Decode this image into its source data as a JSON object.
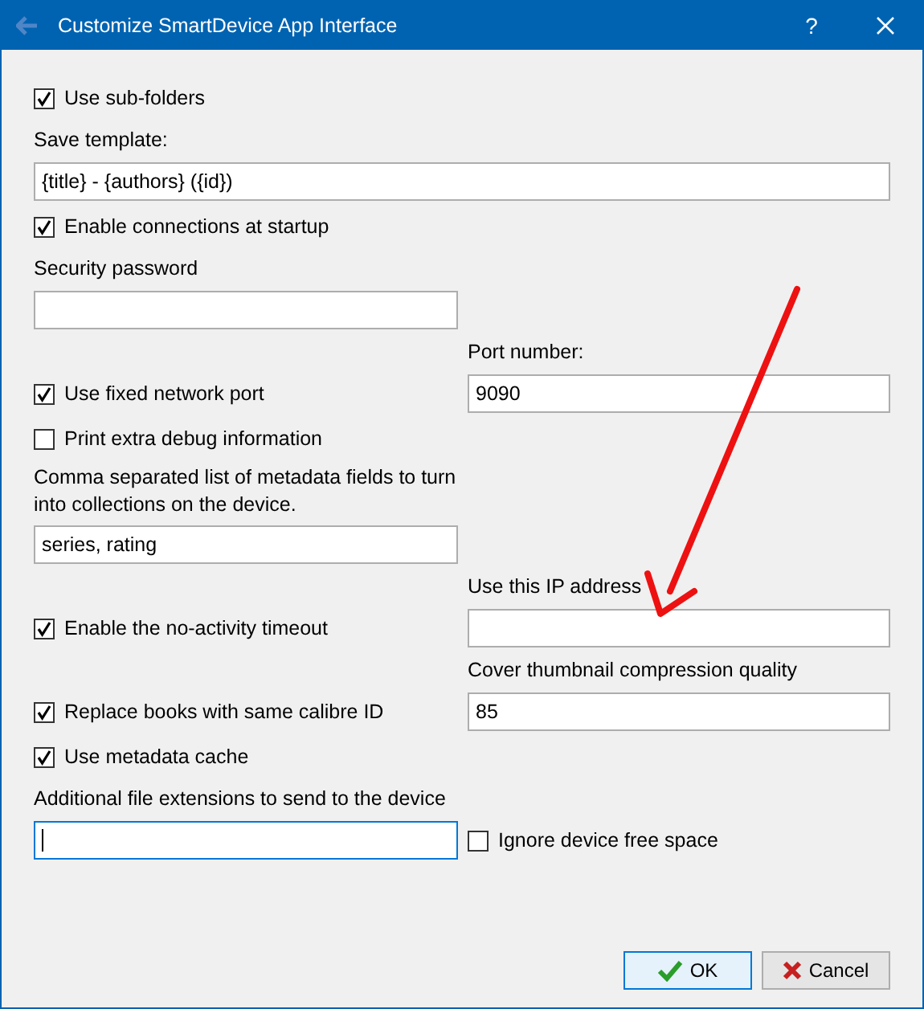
{
  "window": {
    "title": "Customize SmartDevice App Interface",
    "help": "?"
  },
  "rows": [
    {
      "full": {
        "kind": "checkbox",
        "label": "Use sub-folders",
        "checked": true
      }
    },
    {
      "full": {
        "kind": "label",
        "text": "Save template:"
      }
    },
    {
      "full": {
        "kind": "field",
        "value": "{title} - {authors} ({id})",
        "focused": false
      }
    },
    {
      "full": {
        "kind": "checkbox",
        "label": "Enable connections at startup",
        "checked": true
      }
    },
    {
      "left": {
        "kind": "label",
        "text": "Security password"
      }
    },
    {
      "left": {
        "kind": "field",
        "focused": false
      }
    },
    {
      "right": {
        "kind": "label",
        "text": "Port number:"
      }
    },
    {
      "left": {
        "kind": "checkbox",
        "label": "Use fixed network port",
        "checked": true
      },
      "right": {
        "kind": "field",
        "value": "9090",
        "focused": false
      }
    },
    {
      "left": {
        "kind": "checkbox",
        "label": "Print extra debug information",
        "checked": false
      }
    },
    {
      "left": {
        "kind": "label",
        "text": "Comma separated list of metadata fields to turn into collections on the device."
      }
    },
    {
      "left": {
        "kind": "field",
        "value": "series, rating",
        "focused": false
      }
    },
    {
      "right": {
        "kind": "label",
        "text": "Use this IP address"
      }
    },
    {
      "left": {
        "kind": "checkbox",
        "label": "Enable the no-activity timeout",
        "checked": true
      },
      "right": {
        "kind": "field",
        "focused": false
      }
    },
    {
      "right": {
        "kind": "label",
        "text": "Cover thumbnail compression quality"
      }
    },
    {
      "left": {
        "kind": "checkbox",
        "label": "Replace books with same calibre ID",
        "checked": true
      },
      "right": {
        "kind": "field",
        "value": "85",
        "focused": false
      }
    },
    {
      "left": {
        "kind": "checkbox",
        "label": "Use metadata cache",
        "checked": true
      }
    },
    {
      "left": {
        "kind": "label",
        "text": "Additional file extensions to send to the device"
      }
    },
    {
      "left": {
        "kind": "field",
        "focused": true
      },
      "right": {
        "kind": "checkbox",
        "label": "Ignore device free space",
        "checked": false
      }
    }
  ],
  "buttons": [
    {
      "kind": "ok",
      "label": "OK",
      "default": true
    },
    {
      "kind": "cancel",
      "label": "Cancel",
      "default": false
    }
  ]
}
